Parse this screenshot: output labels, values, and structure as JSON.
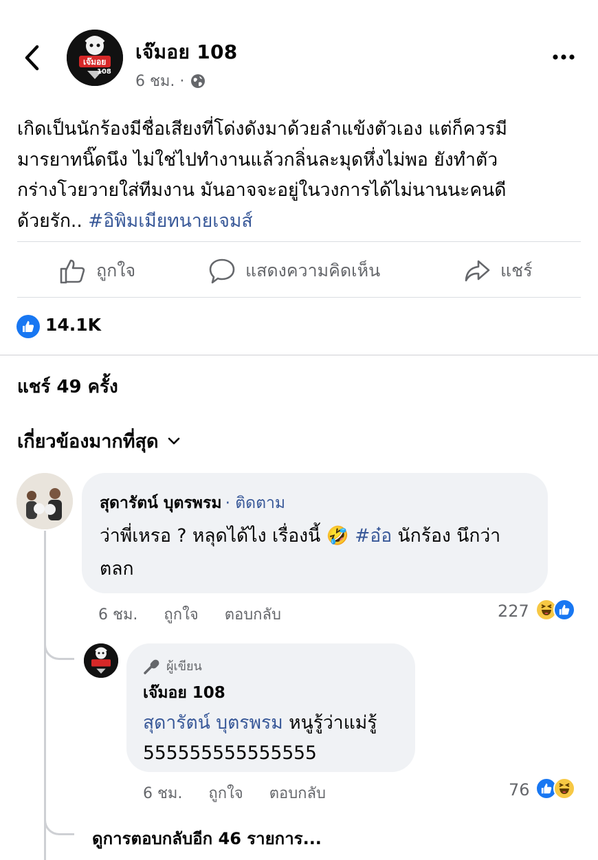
{
  "post": {
    "page_name": "เจ๊มอย 108",
    "avatar_text": "เจ๊มอย",
    "avatar_number": "108",
    "time": "6 ชม. ·",
    "text_lines": [
      "เกิดเป็นนักร้องมีชื่อเสียงที่โด่งดังมาด้วยลำแข้งตัวเอง แต่ก็ควรมี",
      "มารยาทนิ๊ดนึง ไม่ใช่ไปทำงานแล้วกลิ่นละมุดหึ่งไม่พอ ยังทำตัว",
      "กร่างโวยวายใส่ทีมงาน มันอาจจะอยู่ในวงการได้ไม่นานนะคนดี"
    ],
    "text_last": "ด้วยรัก.. ",
    "hashtag": "#อิพิมเมียทนายเจมส์"
  },
  "actions": {
    "like": "ถูกใจ",
    "comment": "แสดงความคิดเห็น",
    "share": "แชร์"
  },
  "reactions": {
    "count": "14.1K",
    "icon": "like-icon"
  },
  "shares": "แชร์ 49 ครั้ง",
  "sort_label": "เกี่ยวข้องมากที่สุด",
  "comments": [
    {
      "author": "สุดารัตน์ บุตรพรม",
      "follow": "· ติดตาม",
      "text_part1": "ว่าพี่เหรอ ? หลุดได้ไง เรื่องนี้ 🤣 ",
      "hashtag": "#อ๋อ",
      "text_part2": " นักร้อง นึกว่า",
      "text_line2": "ตลก",
      "time": "6 ชม.",
      "like": "ถูกใจ",
      "reply": "ตอบกลับ",
      "reaction_count": "227",
      "reaction_icons": [
        "haha-icon",
        "like-icon"
      ]
    }
  ],
  "replies": [
    {
      "badge": "ผู้เขียน",
      "author": "เจ๊มอย 108",
      "mention": "สุดารัตน์ บุตรพรม",
      "text": " หนูรู้ว่าแม่รู้",
      "text_line2": "555555555555555",
      "time": "6 ชม.",
      "like": "ถูกใจ",
      "reply": "ตอบกลับ",
      "reaction_count": "76",
      "reaction_icons": [
        "like-icon",
        "haha-icon"
      ]
    }
  ],
  "view_more": "ดูการตอบกลับอีก 46 รายการ...",
  "colors": {
    "link": "#385898",
    "secondary_text": "#65676b",
    "bubble": "#f0f2f5",
    "like_blue": "#1877f2",
    "haha_yellow": "#f7c844"
  }
}
